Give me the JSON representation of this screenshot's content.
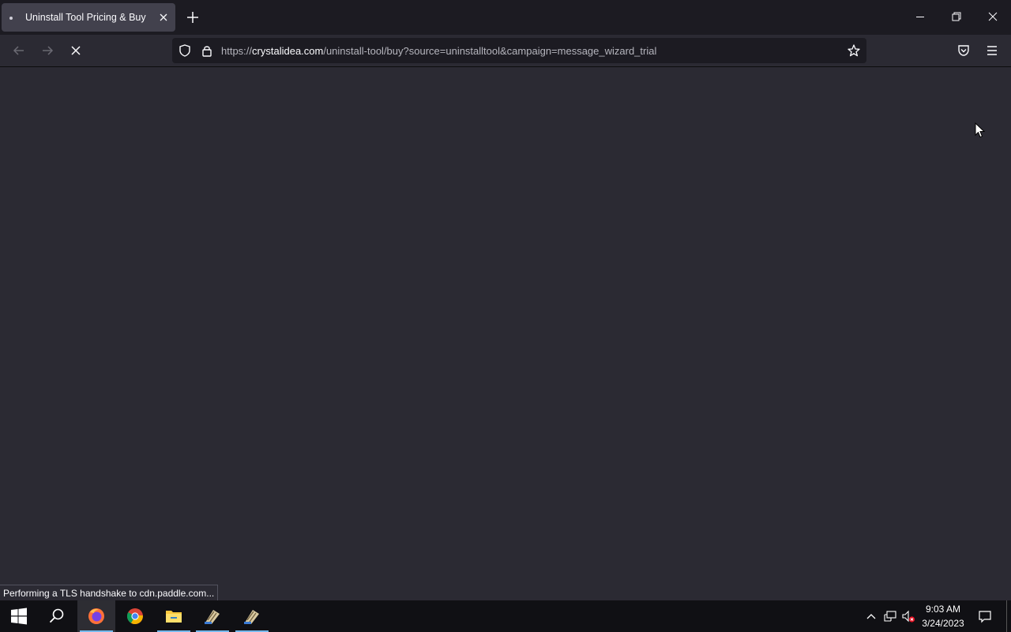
{
  "browser": {
    "tab": {
      "title": "Uninstall Tool Pricing & Buy"
    },
    "url": {
      "scheme": "https://",
      "host": "crystalidea.com",
      "path": "/uninstall-tool/buy?source=uninstalltool&campaign=message_wizard_trial"
    },
    "status_text": "Performing a TLS handshake to cdn.paddle.com..."
  },
  "taskbar": {
    "apps": [
      "start-icon",
      "search-icon",
      "firefox-icon",
      "chrome-icon",
      "file-explorer-icon",
      "uninstall-tool-icon",
      "uninstall-tool-icon"
    ],
    "clock": {
      "time": "9:03 AM",
      "date": "3/24/2023"
    }
  },
  "colors": {
    "accent": "#76b9ed",
    "chrome_bg": "#1c1b22",
    "content_bg": "#2b2a33"
  }
}
